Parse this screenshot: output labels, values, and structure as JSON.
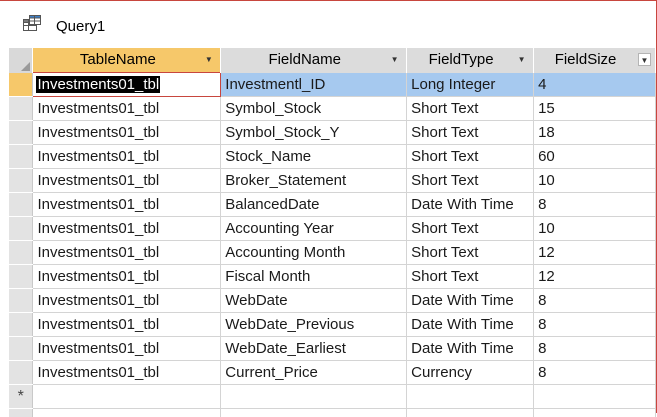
{
  "tab": {
    "title": "Query1",
    "icon": "query-datasheet-icon"
  },
  "columns": [
    "TableName",
    "FieldName",
    "FieldType",
    "FieldSize"
  ],
  "colors": {
    "accent": "#c8463e",
    "selected_header": "#f6c86a",
    "current_row": "#a6c9ef"
  },
  "rows": [
    [
      "Investments01_tbl",
      "Investmentl_ID",
      "Long Integer",
      "4"
    ],
    [
      "Investments01_tbl",
      "Symbol_Stock",
      "Short Text",
      "15"
    ],
    [
      "Investments01_tbl",
      "Symbol_Stock_Y",
      "Short Text",
      "18"
    ],
    [
      "Investments01_tbl",
      "Stock_Name",
      "Short Text",
      "60"
    ],
    [
      "Investments01_tbl",
      "Broker_Statement",
      "Short Text",
      "10"
    ],
    [
      "Investments01_tbl",
      "BalancedDate",
      "Date With Time",
      "8"
    ],
    [
      "Investments01_tbl",
      "Accounting Year",
      "Short Text",
      "10"
    ],
    [
      "Investments01_tbl",
      "Accounting Month",
      "Short Text",
      "12"
    ],
    [
      "Investments01_tbl",
      "Fiscal Month",
      "Short Text",
      "12"
    ],
    [
      "Investments01_tbl",
      "WebDate",
      "Date With Time",
      "8"
    ],
    [
      "Investments01_tbl",
      "WebDate_Previous",
      "Date With Time",
      "8"
    ],
    [
      "Investments01_tbl",
      "WebDate_Earliest",
      "Date With Time",
      "8"
    ],
    [
      "Investments01_tbl",
      "Current_Price",
      "Currency",
      "8"
    ]
  ],
  "new_record_marker": "*"
}
